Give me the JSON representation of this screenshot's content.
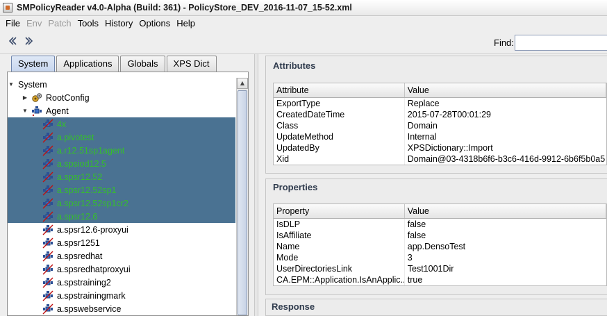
{
  "window": {
    "title": "SMPolicyReader v4.0-Alpha (Build: 361) - PolicyStore_DEV_2016-11-07_15-52.xml",
    "icon": "app-icon"
  },
  "menu": [
    "File",
    "Env",
    "Patch",
    "Tools",
    "History",
    "Options",
    "Help"
  ],
  "menu_disabled": [
    "Env",
    "Patch"
  ],
  "toolbar": {
    "back_icon": "chevron-left-icon",
    "forward_icon": "chevron-right-icon",
    "find_label": "Find:",
    "find_value": ""
  },
  "tabs": [
    {
      "label": "System",
      "active": true
    },
    {
      "label": "Applications",
      "active": false
    },
    {
      "label": "Globals",
      "active": false
    },
    {
      "label": "XPS Dict",
      "active": false
    }
  ],
  "tree": {
    "root": "System",
    "rootconfig": "RootConfig",
    "agent": "Agent",
    "items": [
      {
        "label": "4x",
        "selected": true
      },
      {
        "label": "a.pivotest",
        "selected": true
      },
      {
        "label": "a.r12.51sp1agent",
        "selected": true
      },
      {
        "label": "a.spsiod12.5",
        "selected": true
      },
      {
        "label": "a.spsr12.52",
        "selected": true
      },
      {
        "label": "a.spsr12.52sp1",
        "selected": true
      },
      {
        "label": "a.spsr12.52sp1cr2",
        "selected": true
      },
      {
        "label": "a.spsr12.6",
        "selected": true
      },
      {
        "label": "a.spsr12.6-proxyui",
        "selected": false
      },
      {
        "label": "a.spsr1251",
        "selected": false
      },
      {
        "label": "a.spsredhat",
        "selected": false
      },
      {
        "label": "a.spsredhatproxyui",
        "selected": false
      },
      {
        "label": "a.spstraining2",
        "selected": false
      },
      {
        "label": "a.spstrainingmark",
        "selected": false
      },
      {
        "label": "a.spswebservice",
        "selected": false
      }
    ]
  },
  "attributes": {
    "title": "Attributes",
    "col1": "Attribute",
    "col2": "Value",
    "rows": [
      [
        "ExportType",
        "Replace"
      ],
      [
        "CreatedDateTime",
        "2015-07-28T00:01:29"
      ],
      [
        "Class",
        "Domain"
      ],
      [
        "UpdateMethod",
        "Internal"
      ],
      [
        "UpdatedBy",
        "XPSDictionary::Import"
      ],
      [
        "Xid",
        "Domain@03-4318b6f6-b3c6-416d-9912-6b6f5b0a5"
      ]
    ]
  },
  "properties": {
    "title": "Properties",
    "col1": "Property",
    "col2": "Value",
    "rows": [
      [
        "IsDLP",
        "false"
      ],
      [
        "IsAffiliate",
        "false"
      ],
      [
        "Name",
        "app.DensoTest"
      ],
      [
        "Mode",
        "3"
      ],
      [
        "UserDirectoriesLink",
        "Test1001Dir"
      ],
      [
        "CA.EPM::Application.IsAnApplic...",
        "true"
      ]
    ]
  },
  "response": {
    "title": "Response"
  }
}
